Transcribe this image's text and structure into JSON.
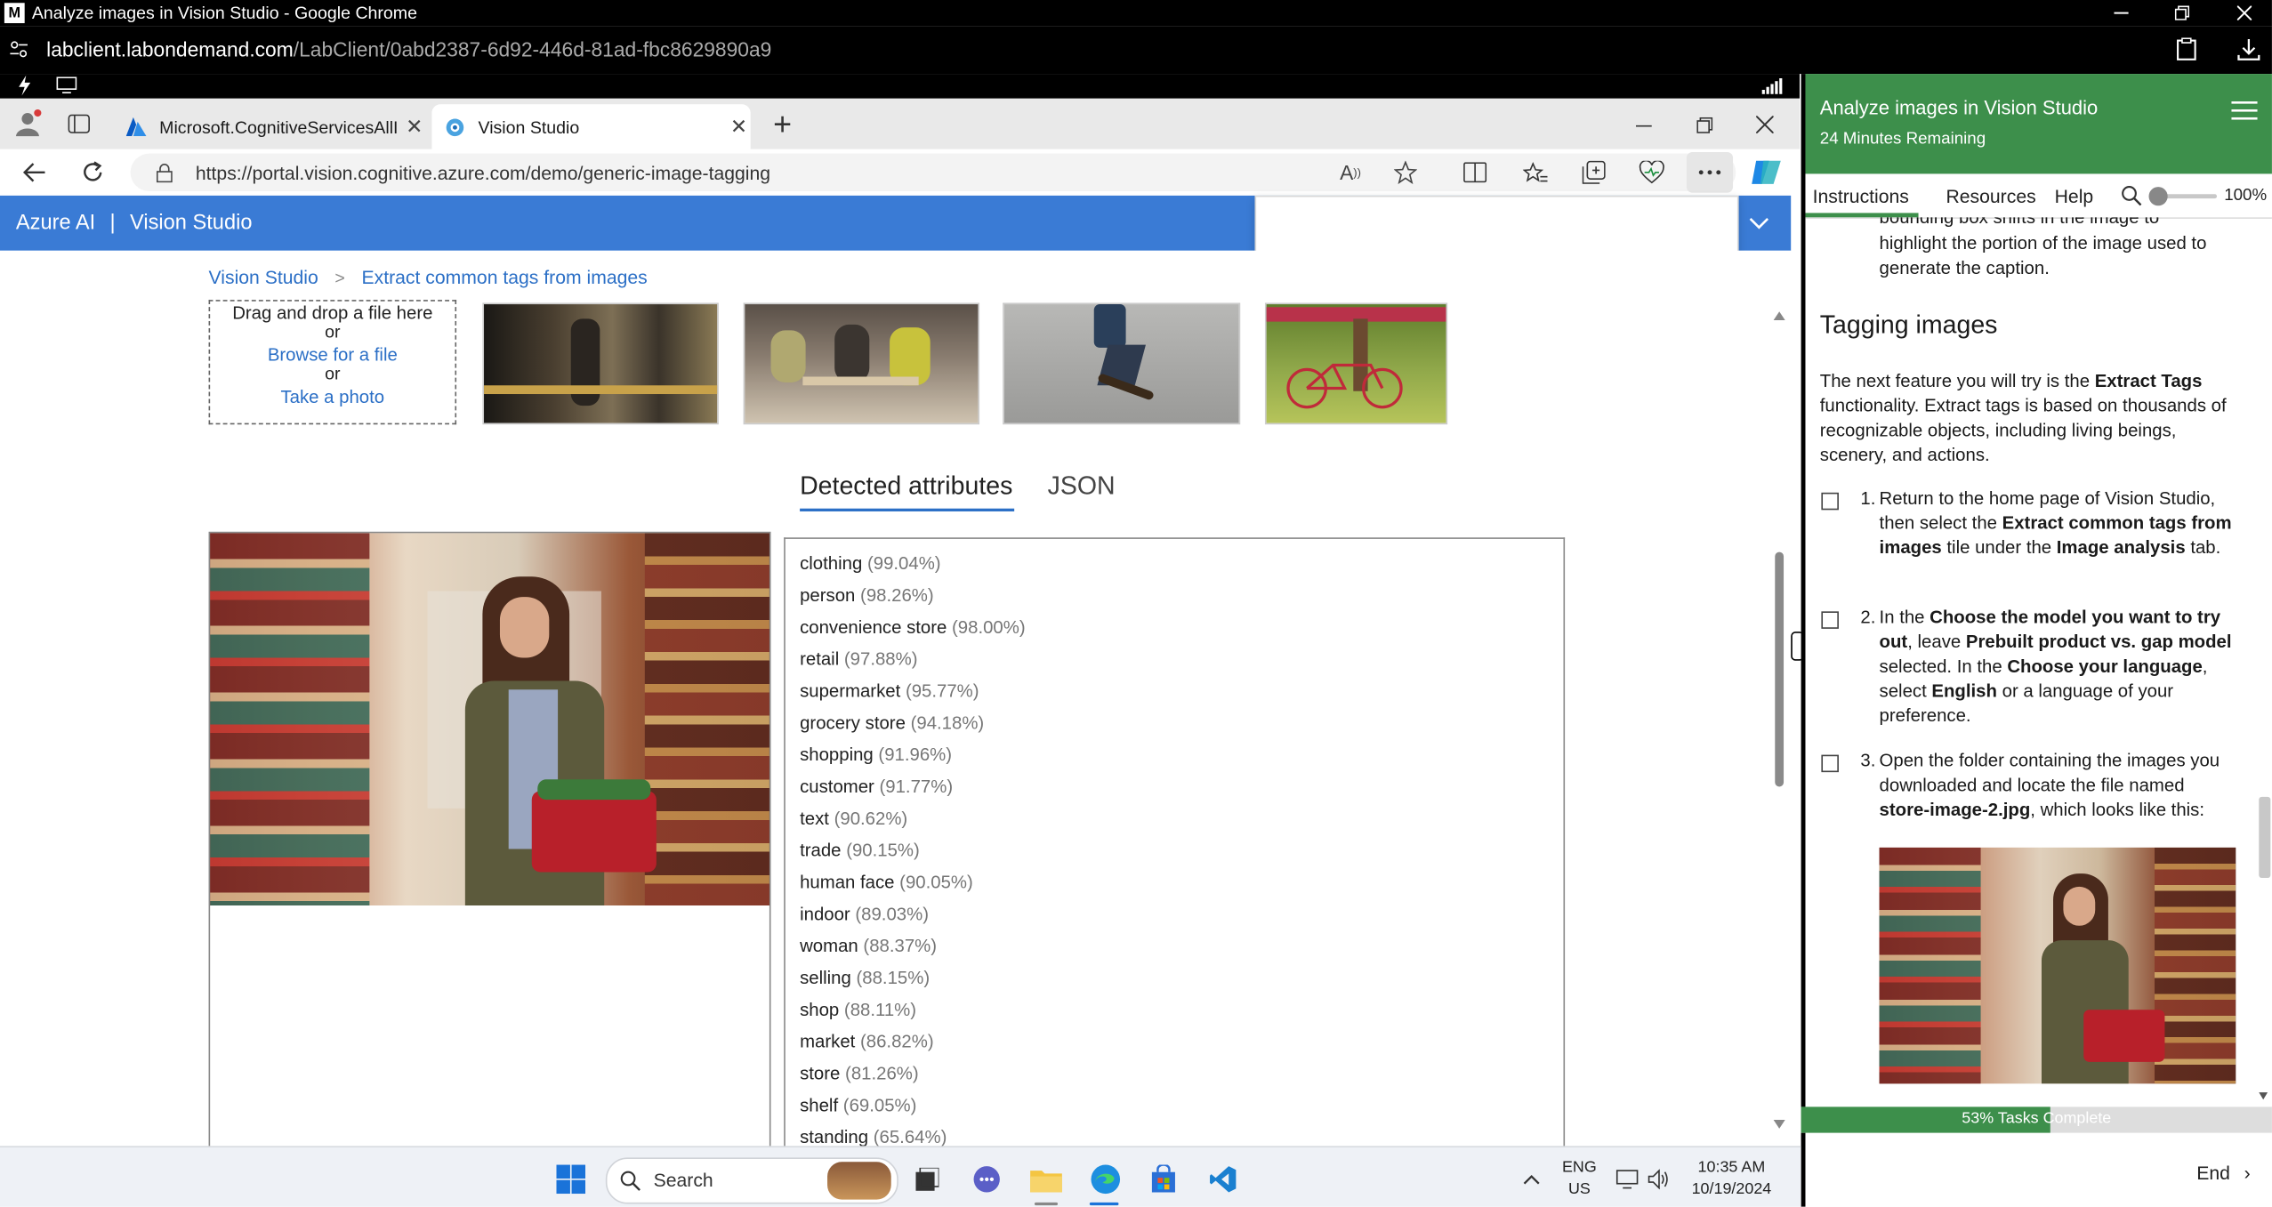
{
  "chrome": {
    "title": "Analyze images in Vision Studio - Google Chrome",
    "url_domain": "labclient.labondemand.com",
    "url_path": "/LabClient/0abd2387-6d92-446d-81ad-fbc8629890a9"
  },
  "edge": {
    "tabs": [
      {
        "label": "Microsoft.CognitiveServicesAllInO"
      },
      {
        "label": "Vision Studio"
      }
    ],
    "address": "https://portal.vision.cognitive.azure.com/demo/generic-image-tagging"
  },
  "azure": {
    "brand": "Azure AI",
    "separator": "|",
    "product": "Vision Studio"
  },
  "breadcrumb": {
    "home": "Vision Studio",
    "sep": ">",
    "current": "Extract common tags from images"
  },
  "upload": {
    "drag_text": "Drag and drop a file here",
    "or1": "or",
    "browse": "Browse for a file",
    "or2": "or",
    "take_photo": "Take a photo"
  },
  "result_tabs": {
    "detected": "Detected attributes",
    "json": "JSON"
  },
  "tags": [
    {
      "name": "clothing",
      "pct": "(99.04%)"
    },
    {
      "name": "person",
      "pct": "(98.26%)"
    },
    {
      "name": "convenience store",
      "pct": "(98.00%)"
    },
    {
      "name": "retail",
      "pct": "(97.88%)"
    },
    {
      "name": "supermarket",
      "pct": "(95.77%)"
    },
    {
      "name": "grocery store",
      "pct": "(94.18%)"
    },
    {
      "name": "shopping",
      "pct": "(91.96%)"
    },
    {
      "name": "customer",
      "pct": "(91.77%)"
    },
    {
      "name": "text",
      "pct": "(90.62%)"
    },
    {
      "name": "trade",
      "pct": "(90.15%)"
    },
    {
      "name": "human face",
      "pct": "(90.05%)"
    },
    {
      "name": "indoor",
      "pct": "(89.03%)"
    },
    {
      "name": "woman",
      "pct": "(88.37%)"
    },
    {
      "name": "selling",
      "pct": "(88.15%)"
    },
    {
      "name": "shop",
      "pct": "(88.11%)"
    },
    {
      "name": "market",
      "pct": "(86.82%)"
    },
    {
      "name": "store",
      "pct": "(81.26%)"
    },
    {
      "name": "shelf",
      "pct": "(69.05%)"
    },
    {
      "name": "standing",
      "pct": "(65.64%)"
    }
  ],
  "lab": {
    "title": "Analyze images in Vision Studio",
    "time_remaining": "24 Minutes Remaining",
    "nav": {
      "instructions": "Instructions",
      "resources": "Resources",
      "help": "Help",
      "zoom": "100%"
    },
    "partial_top": "bounding box shifts in the image to",
    "caption_text": "highlight the portion of the image used to generate the caption.",
    "section_heading": "Tagging images",
    "intro_1": "The next feature you will try is the ",
    "intro_bold": "Extract Tags",
    "intro_2": " functionality. Extract tags is based on thousands of recognizable objects, including living beings, scenery, and actions.",
    "step1": {
      "num": "1.",
      "a": "Return to the home page of Vision Studio, then select the ",
      "b": "Extract common tags from images",
      "c": " tile under the ",
      "d": "Image analysis",
      "e": " tab."
    },
    "step2": {
      "num": "2.",
      "a": "In the ",
      "b": "Choose the model you want to try out",
      "c": ", leave ",
      "d": "Prebuilt product vs. gap model",
      "e": " selected. In the ",
      "f": "Choose your language",
      "g": ", select ",
      "h": "English",
      "i": " or a language of your preference."
    },
    "step3": {
      "num": "3.",
      "a": "Open the folder containing the images you downloaded and locate the file named ",
      "b": "store-image-2.jpg",
      "c": ", which looks like this:"
    },
    "progress_text": "53% Tasks Complete",
    "progress_value": 0.53,
    "end_label": "End"
  },
  "taskbar": {
    "search": "Search",
    "lang": "ENG",
    "region": "US",
    "time": "10:35 AM",
    "date": "10/19/2024"
  },
  "colors": {
    "azure_blue": "#3a7bd5",
    "lab_green": "#3d8f4b",
    "link_blue": "#2b6fc6"
  }
}
